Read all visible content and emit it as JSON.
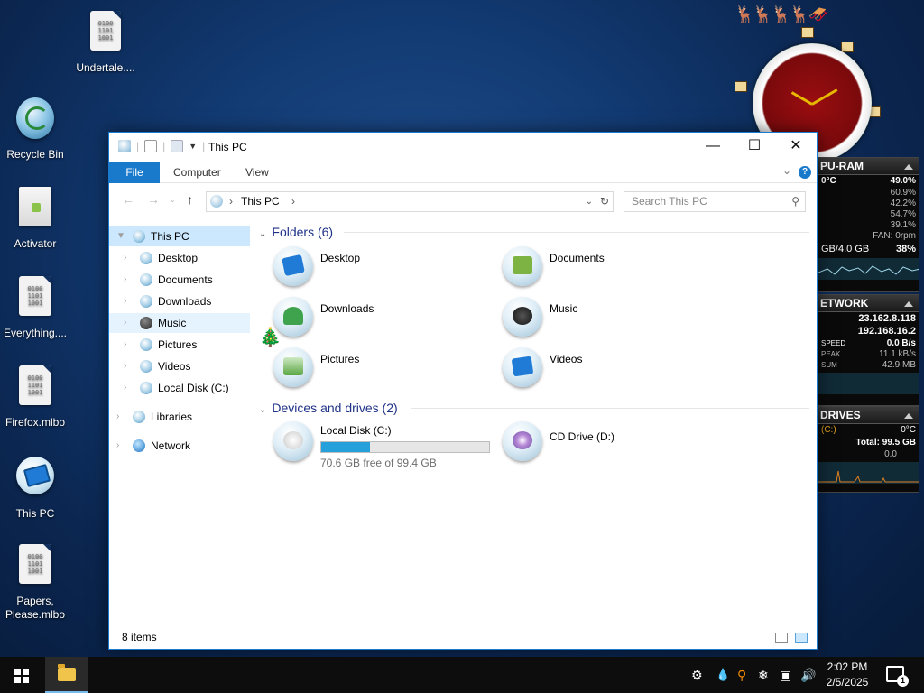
{
  "desktop": {
    "icons": [
      {
        "label": "Undertale...."
      },
      {
        "label": "Recycle Bin"
      },
      {
        "label": "Activator"
      },
      {
        "label": "Everything...."
      },
      {
        "label": "Firefox.mlbo"
      },
      {
        "label": "This PC"
      },
      {
        "label": "Papers, Please.mlbo"
      }
    ],
    "file_glyph": "0100\n1101\n1001"
  },
  "gadgets": {
    "cpu": {
      "title": "PU-RAM",
      "temp": "0°C",
      "total": "49.0%",
      "cores": [
        "60.9%",
        "42.2%",
        "54.7%",
        "39.1%"
      ],
      "fan": "FAN: 0rpm",
      "ram": "GB/4.0 GB",
      "ram_pct": "38%"
    },
    "network": {
      "title": "ETWORK",
      "ip_public": "23.162.8.118",
      "ip_local": "192.168.16.2",
      "speed_label": "SPEED",
      "speed_value": "0.0 B/s",
      "peak_label": "PEAK",
      "peak_value": "11.1 kB/s",
      "sum_label": "SUM",
      "sum_value": "42.9 MB"
    },
    "drives": {
      "title": "DRIVES",
      "drive": "(C:)",
      "temp": "0°C",
      "total": "Total: 99.5 GB",
      "activity": "0.0"
    }
  },
  "window": {
    "title": "This PC",
    "tabs": {
      "file": "File",
      "computer": "Computer",
      "view": "View"
    },
    "help": "?",
    "address": {
      "crumb": "This PC"
    },
    "search": {
      "placeholder": "Search This PC"
    },
    "sidebar": {
      "this_pc": "This PC",
      "items": [
        "Desktop",
        "Documents",
        "Downloads",
        "Music",
        "Pictures",
        "Videos",
        "Local Disk (C:)"
      ],
      "libraries": "Libraries",
      "network": "Network"
    },
    "groups": {
      "folders": "Folders (6)",
      "devices": "Devices and drives (2)"
    },
    "folders": [
      "Desktop",
      "Documents",
      "Downloads",
      "Music",
      "Pictures",
      "Videos"
    ],
    "drives": [
      {
        "name": "Local Disk (C:)",
        "free": "70.6 GB free of 99.4 GB",
        "used_fraction": 0.29
      },
      {
        "name": "CD Drive (D:)"
      }
    ],
    "status": "8 items"
  },
  "taskbar": {
    "time": "2:02 PM",
    "date": "2/5/2025",
    "notifications": "1"
  },
  "colors": {
    "accent": "#1979ca",
    "selection": "#cce8ff",
    "drive_bar": "#26a0da",
    "group_heading": "#1e3287"
  }
}
